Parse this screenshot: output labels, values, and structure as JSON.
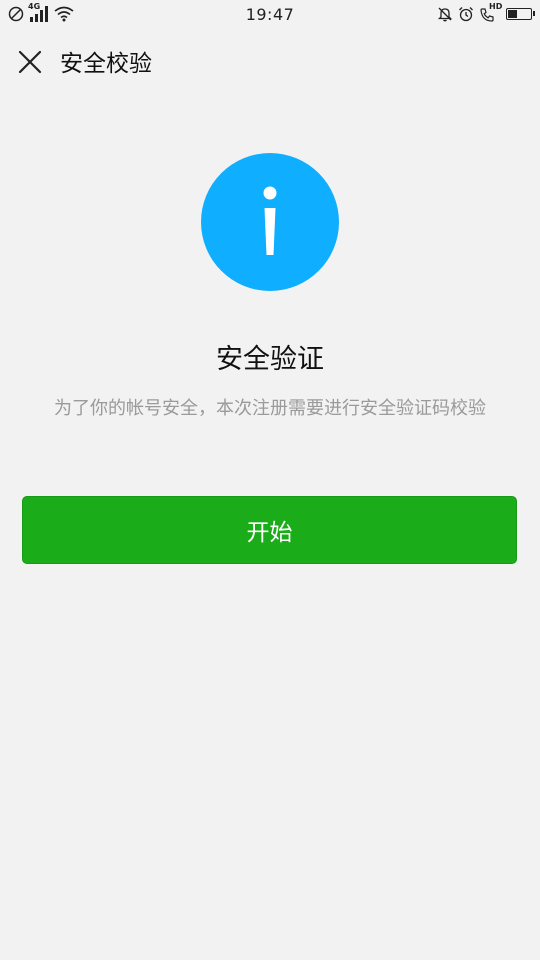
{
  "status_bar": {
    "time": "19:47",
    "network_label": "4G",
    "hd_label": "HD",
    "battery_level": 0.45,
    "icons": [
      "block-icon",
      "signal-icon",
      "wifi-icon",
      "mute-icon",
      "alarm-icon",
      "hd-call-icon",
      "battery-icon"
    ]
  },
  "header": {
    "title": "安全校验",
    "close_icon": "close-icon"
  },
  "main": {
    "icon": "info-icon",
    "title": "安全验证",
    "description": "为了你的帐号安全，本次注册需要进行安全验证码校验",
    "start_button_label": "开始"
  },
  "colors": {
    "accent": "#10aeff",
    "primary": "#1aad19",
    "background": "#f2f2f2",
    "secondary_text": "#9a9a9a"
  }
}
